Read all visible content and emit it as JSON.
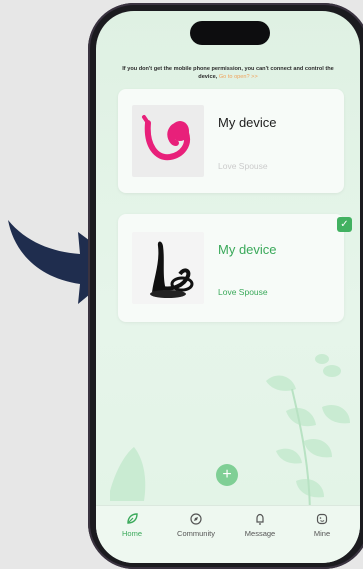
{
  "notice": {
    "text": "If you don't get the mobile phone permission, you can't connect and control the device,",
    "link": "Go to open? >>"
  },
  "devices": [
    {
      "name": "My device",
      "brand": "Love Spouse",
      "selected": false,
      "image_icon": "pink-device-icon"
    },
    {
      "name": "My device",
      "brand": "Love Spouse",
      "selected": true,
      "image_icon": "black-device-icon"
    }
  ],
  "tabs": [
    {
      "label": "Home",
      "icon": "leaf-icon",
      "active": true
    },
    {
      "label": "Community",
      "icon": "compass-icon",
      "active": false
    },
    {
      "label": "Message",
      "icon": "bell-icon",
      "active": false
    },
    {
      "label": "Mine",
      "icon": "face-icon",
      "active": false
    }
  ],
  "add_button": "+",
  "check_mark": "✓",
  "colors": {
    "accent": "#3aa95a",
    "background": "#e0f2e4",
    "arrow": "#1f2d4e",
    "pink": "#e8207a"
  }
}
